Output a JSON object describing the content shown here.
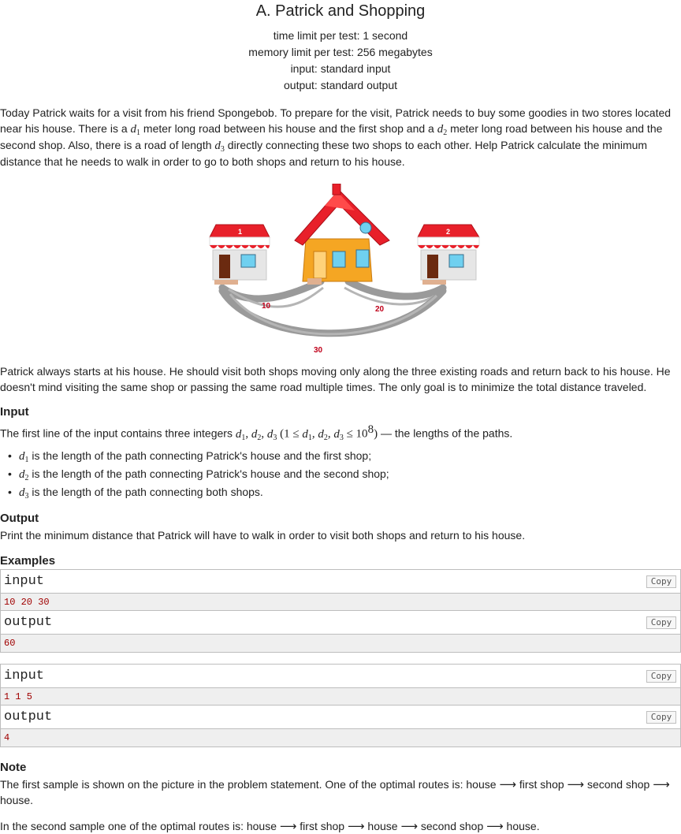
{
  "problem": {
    "title": "A. Patrick and Shopping",
    "meta": [
      "time limit per test: 1 second",
      "memory limit per test: 256 megabytes",
      "input: standard input",
      "output: standard output"
    ]
  },
  "statement": {
    "p1": {
      "t1": "Today Patrick waits for a visit from his friend Spongebob. To prepare for the visit, Patrick needs to buy some goodies in two stores located near his house. There is a ",
      "t2": " meter long road between his house and the first shop and a ",
      "t3": " meter long road between his house and the second shop. Also, there is a road of length ",
      "t4": " directly connecting these two shops to each other. Help Patrick calculate the minimum distance that he needs to walk in order to go to both shops and return to his house."
    },
    "math": {
      "d": "d",
      "s1": "1",
      "s2": "2",
      "s3": "3"
    },
    "figure": {
      "shop1_number": "1",
      "shop2_number": "2",
      "road_house_shop1": "10",
      "road_house_shop2": "20",
      "road_shop1_shop2": "30",
      "colors": {
        "roof": "#e8202a",
        "wall": "#f5a623",
        "road": "#9a9a9a",
        "label": "#c0001a"
      }
    },
    "p2": "Patrick always starts at his house. He should visit both shops moving only along the three existing roads and return back to his house. He doesn't mind visiting the same shop or passing the same road multiple times. The only goal is to minimize the total distance traveled."
  },
  "input_section": {
    "title": "Input",
    "line_prefix": "The first line of the input contains three integers ",
    "constraint": {
      "open": "(1 ≤ ",
      "le": " ≤ 10",
      "exp": "8",
      "close": ")"
    },
    "line_suffix": " — the lengths of the paths.",
    "bullets": [
      " is the length of the path connecting Patrick's house and the first shop;",
      " is the length of the path connecting Patrick's house and the second shop;",
      " is the length of the path connecting both shops."
    ]
  },
  "output_section": {
    "title": "Output",
    "text": "Print the minimum distance that Patrick will have to walk in order to visit both shops and return to his house."
  },
  "examples": {
    "title": "Examples",
    "input_label": "input",
    "output_label": "output",
    "copy_label": "Copy",
    "tests": [
      {
        "input": "10 20 30",
        "output": "60"
      },
      {
        "input": "1 1 5",
        "output": "4"
      }
    ]
  },
  "note": {
    "title": "Note",
    "p1": {
      "t1": "The first sample is shown on the picture in the problem statement. One of the optimal routes is: house ",
      "s1": " first shop ",
      "s2": " second shop ",
      "t2": "house."
    },
    "p2": {
      "t1": "In the second sample one of the optimal routes is: house ",
      "s1": " first shop ",
      "s2": " house ",
      "s3": " second shop ",
      "t2": " house."
    },
    "arrow": "⟶"
  }
}
